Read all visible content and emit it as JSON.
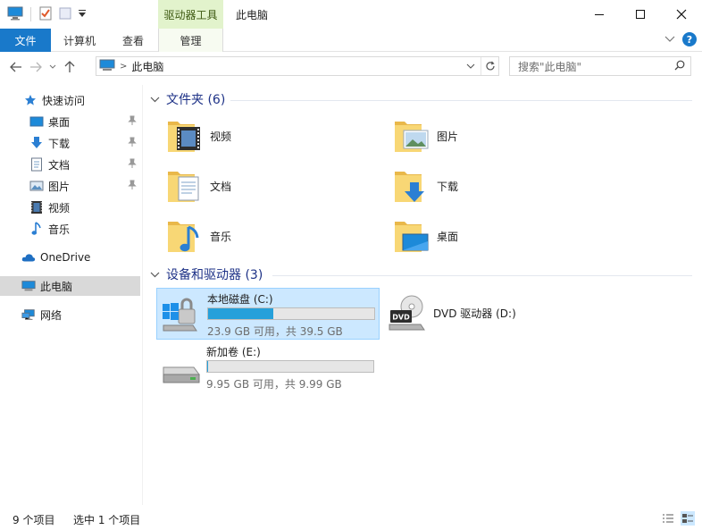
{
  "window": {
    "contextual_tab": "驱动器工具",
    "title": "此电脑"
  },
  "ribbon": {
    "file_tab": "文件",
    "computer_tab": "计算机",
    "view_tab": "查看",
    "manage_tab": "管理",
    "help": "?"
  },
  "address": {
    "path": "此电脑",
    "search_placeholder": "搜索\"此电脑\""
  },
  "sidebar": {
    "items": [
      {
        "label": "快速访问",
        "icon": "star-icon"
      },
      {
        "label": "桌面",
        "icon": "desktop-icon",
        "pinned": true
      },
      {
        "label": "下载",
        "icon": "download-icon",
        "pinned": true
      },
      {
        "label": "文档",
        "icon": "document-icon",
        "pinned": true
      },
      {
        "label": "图片",
        "icon": "pictures-icon",
        "pinned": true
      },
      {
        "label": "视频",
        "icon": "video-icon"
      },
      {
        "label": "音乐",
        "icon": "music-icon"
      },
      {
        "label": "OneDrive",
        "icon": "onedrive-icon"
      },
      {
        "label": "此电脑",
        "icon": "this-pc-icon",
        "selected": true
      },
      {
        "label": "网络",
        "icon": "network-icon"
      }
    ]
  },
  "folders_group": {
    "header": "文件夹 (6)",
    "items": [
      {
        "label": "视频",
        "icon": "video-folder-icon"
      },
      {
        "label": "图片",
        "icon": "pictures-folder-icon"
      },
      {
        "label": "文档",
        "icon": "documents-folder-icon"
      },
      {
        "label": "下载",
        "icon": "downloads-folder-icon"
      },
      {
        "label": "音乐",
        "icon": "music-folder-icon"
      },
      {
        "label": "桌面",
        "icon": "desktop-folder-icon"
      }
    ]
  },
  "drives_group": {
    "header": "设备和驱动器 (3)",
    "items": [
      {
        "label": "本地磁盘 (C:)",
        "free_text": "23.9 GB 可用，共 39.5 GB",
        "used_fraction": 0.395,
        "selected": true,
        "icon": "windows-drive-icon"
      },
      {
        "label": "DVD 驱动器 (D:)",
        "icon": "dvd-drive-icon",
        "dvd_badge": "DVD"
      },
      {
        "label": "新加卷 (E:)",
        "free_text": "9.95 GB 可用，共 9.99 GB",
        "used_fraction": 0.004,
        "icon": "hard-drive-icon"
      }
    ]
  },
  "status": {
    "item_count": "9 个项目",
    "selection": "选中 1 个项目"
  },
  "colors": {
    "accent": "#1979ca",
    "selection": "#cce8ff",
    "progress": "#26a0da",
    "group_header": "#1e3287",
    "folder": "#f8d775"
  }
}
